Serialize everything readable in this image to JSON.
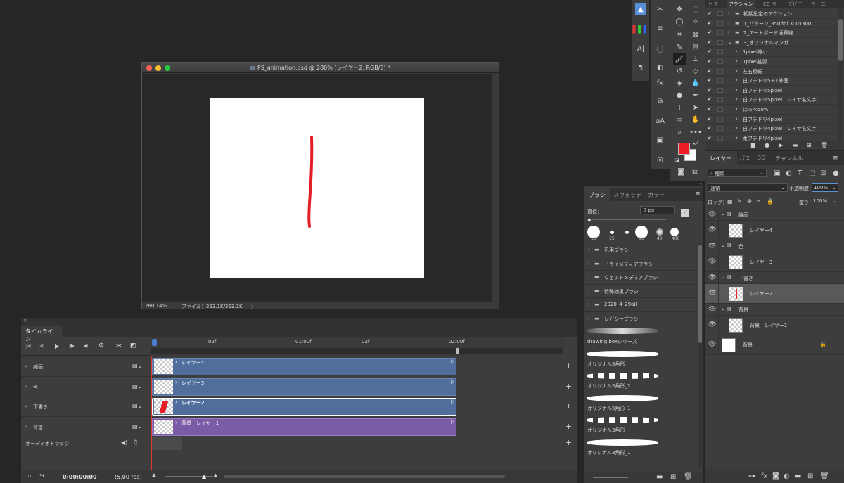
{
  "document": {
    "title": "PS_animation.psd @ 280% (レイヤー2, RGB/8) *",
    "zoom": "280.14%",
    "file_info": "ファイル：253.1K/253.1K",
    "status_chevron": "〉"
  },
  "actions_panel": {
    "tabs": [
      "ヒスト",
      "アクション",
      "CC ラ",
      "デビテ",
      "ラーニ"
    ],
    "active_tab": "アクション",
    "items": [
      {
        "label": "初期設定のアクション",
        "level": 0,
        "folder": true
      },
      {
        "label": "1_パターン_350dpi  300x300",
        "level": 0,
        "folder": true
      },
      {
        "label": "2_アートボード境界線",
        "level": 0,
        "folder": true
      },
      {
        "label": "3_オリジナルマンガ",
        "level": 0,
        "folder": true,
        "expanded": true
      },
      {
        "label": "1pixel縮小",
        "level": 1
      },
      {
        "label": "1pixel拡張",
        "level": 1
      },
      {
        "label": "左右反転",
        "level": 1
      },
      {
        "label": "白フチドリ5＋1外囲",
        "level": 1
      },
      {
        "label": "白フチドリ5pixel",
        "level": 1
      },
      {
        "label": "白フチドリ5pixel　レイヤ名文字",
        "level": 1
      },
      {
        "label": "ほっぺ50%",
        "level": 1
      },
      {
        "label": "白フチドリ4pixel",
        "level": 1
      },
      {
        "label": "白フチドリ4pixel　レイヤ名文字",
        "level": 1
      },
      {
        "label": "柔フチドリ4pixel",
        "level": 1
      }
    ]
  },
  "layers_panel": {
    "tabs": [
      "レイヤー",
      "パス",
      "3D",
      "チャンネル"
    ],
    "active_tab": "レイヤー",
    "filter_kind": "種類",
    "blend_mode": "通常",
    "opacity_label": "不透明度：",
    "opacity_value": "100%",
    "lock_label": "ロック：",
    "fill_label": "塗り：",
    "fill_value": "100%",
    "layers": [
      {
        "name": "線画",
        "type": "group"
      },
      {
        "name": "レイヤー4",
        "type": "layer"
      },
      {
        "name": "色",
        "type": "group"
      },
      {
        "name": "レイヤー3",
        "type": "layer"
      },
      {
        "name": "下書き",
        "type": "group"
      },
      {
        "name": "レイヤー2",
        "type": "layer",
        "selected": true
      },
      {
        "name": "背景",
        "type": "group"
      },
      {
        "name": "背景　レイヤー1",
        "type": "layer"
      },
      {
        "name": "背景",
        "type": "background"
      }
    ]
  },
  "brush_panel": {
    "tabs": [
      "ブラシ",
      "スウォッチ",
      "カラー"
    ],
    "active_tab": "ブラシ",
    "size_label": "直径：",
    "size_value": "7 px",
    "presets": [
      "10",
      "15",
      "",
      "60",
      "40",
      "400"
    ],
    "folders": [
      "汎用ブラシ",
      "ドライメディアブラシ",
      "ウェットメディアブラシ",
      "特殊効果ブラシ",
      "2020_4_29all",
      "レガシーブラシ"
    ],
    "brushes": [
      "drawing boxシリーズ",
      "オリジナル5角形",
      "オリジナル5角形_2",
      "オリジナル5角形_1",
      "オリジナル3角形",
      "オリジナル3角形_1"
    ]
  },
  "timeline": {
    "tab": "タイムライン",
    "ruler_marks": [
      "02f",
      "01:00f",
      "02f",
      "02:00f"
    ],
    "tracks": [
      {
        "label": "線画",
        "clip": "レイヤー4",
        "color": "#4f6e9b"
      },
      {
        "label": "色",
        "clip": "レイヤー3",
        "color": "#4f6e9b"
      },
      {
        "label": "下書き",
        "clip": "レイヤー2",
        "color": "#4f6e9b",
        "selected": true
      },
      {
        "label": "背景",
        "clip": "背景　レイヤー1",
        "color": "#7b5aa6"
      }
    ],
    "audio_track": "オーディオトラック",
    "timecode": "0:00:00:00",
    "fps": "(5.00 fps)"
  },
  "colors": {
    "foreground": "#ee1c24",
    "background": "#ffffff",
    "stroke": "#e3202a",
    "clip_blue": "#4f6e9b",
    "clip_purple": "#7b5aa6"
  }
}
